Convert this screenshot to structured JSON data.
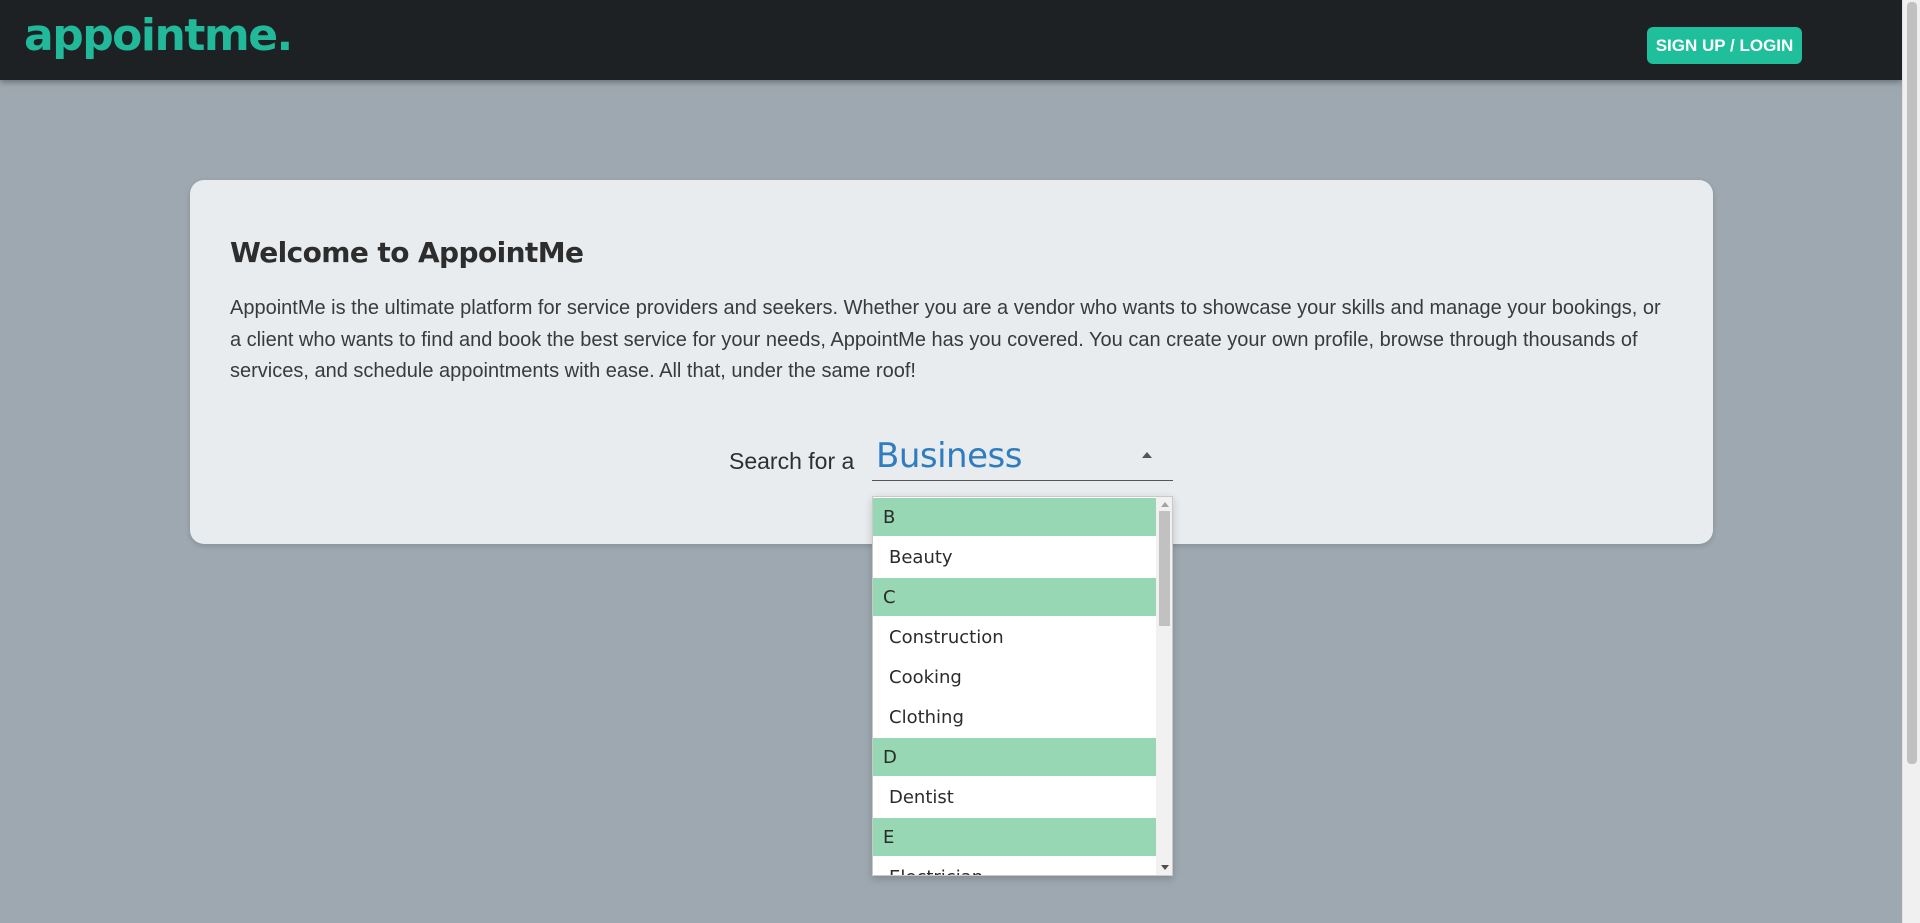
{
  "header": {
    "logo_text": "appointme.",
    "login_label": "SIGN UP / LOGIN"
  },
  "card": {
    "title": "Welcome to AppointMe",
    "description": "AppointMe is the ultimate platform for service providers and seekers. Whether you are a vendor who wants to showcase your skills and manage your bookings, or a client who wants to find and book the best service for your needs, AppointMe has you covered. You can create your own profile, browse through thousands of services, and schedule appointments with ease. All that, under the same roof!",
    "search_label": "Search for a",
    "select_value": "Business"
  },
  "dropdown": {
    "items": [
      {
        "label": "B",
        "group": true
      },
      {
        "label": "Beauty",
        "group": false
      },
      {
        "label": "C",
        "group": true
      },
      {
        "label": "Construction",
        "group": false
      },
      {
        "label": "Cooking",
        "group": false
      },
      {
        "label": "Clothing",
        "group": false
      },
      {
        "label": "D",
        "group": true
      },
      {
        "label": "Dentist",
        "group": false
      },
      {
        "label": "E",
        "group": true
      },
      {
        "label": "Electrician",
        "group": false
      }
    ]
  },
  "colors": {
    "brand": "#21b99a",
    "header_bg": "#1e2123",
    "page_bg": "#9ea8b0",
    "card_bg": "#e8ecee",
    "group_bg": "#98d7b3",
    "select_text": "#2f7dc0"
  },
  "icons": {
    "select_caret": "caret-up-icon",
    "scroll_up": "scroll-up-arrow-icon",
    "scroll_down": "scroll-down-arrow-icon"
  }
}
